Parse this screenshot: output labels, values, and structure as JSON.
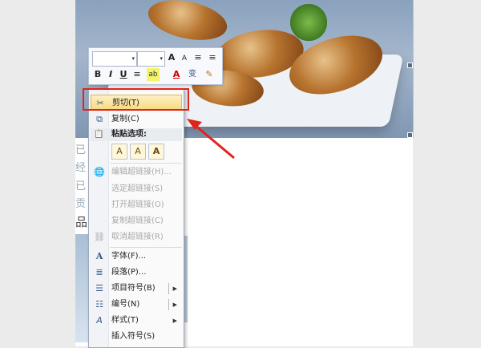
{
  "document": {
    "fragment_1": "已",
    "fragment_2": "经",
    "fragment_3": "已",
    "fragment_4": "贡",
    "fragment_5": "品"
  },
  "mini_toolbar": {
    "font_name": "",
    "font_size": "",
    "grow_font": "A",
    "shrink_font": "A",
    "indent_dec": "≡",
    "indent_inc": "≡",
    "bold": "B",
    "italic": "I",
    "underline": "U",
    "center": "≡",
    "highlight": "ab",
    "font_color": "A",
    "phonetic": "变",
    "format_painter": "✎"
  },
  "context_menu": {
    "cut": "剪切(T)",
    "copy": "复制(C)",
    "paste_options": "粘贴选项:",
    "paste_keep_format": "A",
    "paste_merge": "A",
    "paste_text_only": "A",
    "edit_hyperlink": "编辑超链接(H)...",
    "select_hyperlink": "选定超链接(S)",
    "open_hyperlink": "打开超链接(O)",
    "copy_hyperlink": "复制超链接(C)",
    "remove_hyperlink": "取消超链接(R)",
    "font": "字体(F)...",
    "paragraph": "段落(P)...",
    "bullets": "项目符号(B)",
    "numbering": "编号(N)",
    "styles": "样式(T)",
    "insert_symbol": "插入符号(S)"
  },
  "colors": {
    "highlight": "#f9d97c",
    "annotation": "#e2231a",
    "menu_bg": "#fafafa"
  }
}
